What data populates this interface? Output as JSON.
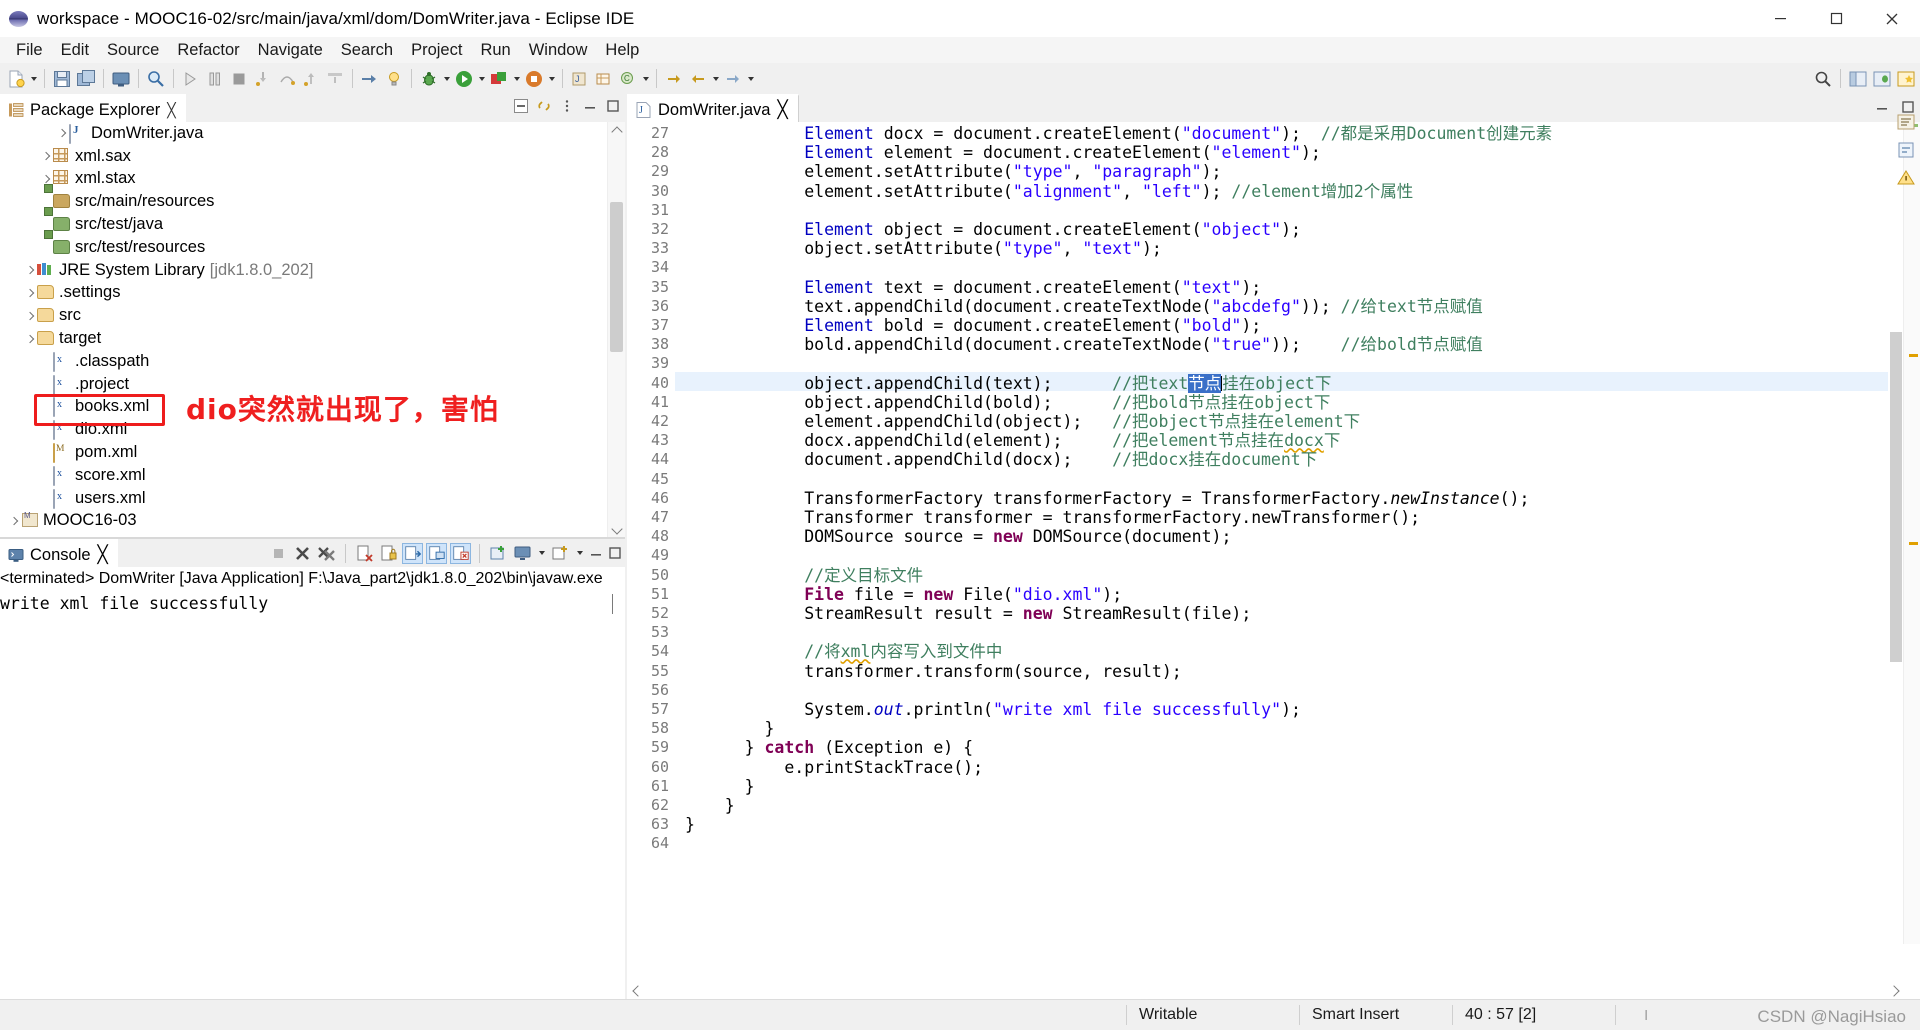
{
  "window": {
    "title": "workspace - MOOC16-02/src/main/java/xml/dom/DomWriter.java - Eclipse IDE",
    "app_icon": "eclipse-sphere-icon",
    "minimize": "minimize-icon",
    "maximize": "maximize-icon",
    "close": "close-icon"
  },
  "menubar": [
    "File",
    "Edit",
    "Source",
    "Refactor",
    "Navigate",
    "Search",
    "Project",
    "Run",
    "Window",
    "Help"
  ],
  "package_explorer": {
    "tab_label": "Package Explorer",
    "close_glyph": "╳",
    "tree": [
      {
        "indent": 3,
        "arrow": true,
        "icon": "java-file-icon",
        "label": "DomWriter.java",
        "sub": ""
      },
      {
        "indent": 2,
        "arrow": true,
        "icon": "package-icon",
        "label": "xml.sax",
        "sub": ""
      },
      {
        "indent": 2,
        "arrow": true,
        "icon": "package-icon",
        "label": "xml.stax",
        "sub": ""
      },
      {
        "indent": 2,
        "arrow": false,
        "icon": "source-folder-icon",
        "label": "src/main/resources",
        "sub": ""
      },
      {
        "indent": 2,
        "arrow": false,
        "icon": "source-folder-green-icon",
        "label": "src/test/java",
        "sub": ""
      },
      {
        "indent": 2,
        "arrow": false,
        "icon": "source-folder-green-icon",
        "label": "src/test/resources",
        "sub": ""
      },
      {
        "indent": 1,
        "arrow": true,
        "icon": "jre-library-icon",
        "label": "JRE System Library",
        "sub": "[jdk1.8.0_202]"
      },
      {
        "indent": 1,
        "arrow": true,
        "icon": "folder-icon",
        "label": ".settings",
        "sub": ""
      },
      {
        "indent": 1,
        "arrow": true,
        "icon": "folder-icon",
        "label": "src",
        "sub": ""
      },
      {
        "indent": 1,
        "arrow": true,
        "icon": "folder-icon",
        "label": "target",
        "sub": ""
      },
      {
        "indent": 2,
        "arrow": false,
        "icon": "xml-file-icon",
        "label": ".classpath",
        "sub": ""
      },
      {
        "indent": 2,
        "arrow": false,
        "icon": "xml-file-icon",
        "label": ".project",
        "sub": ""
      },
      {
        "indent": 2,
        "arrow": false,
        "icon": "xml-file-icon",
        "label": "books.xml",
        "sub": ""
      },
      {
        "indent": 2,
        "arrow": false,
        "icon": "xml-file-icon",
        "label": "dio.xml",
        "sub": ""
      },
      {
        "indent": 2,
        "arrow": false,
        "icon": "maven-pom-icon",
        "label": "pom.xml",
        "sub": ""
      },
      {
        "indent": 2,
        "arrow": false,
        "icon": "xml-file-icon",
        "label": "score.xml",
        "sub": ""
      },
      {
        "indent": 2,
        "arrow": false,
        "icon": "xml-file-icon",
        "label": "users.xml",
        "sub": ""
      },
      {
        "indent": 0,
        "arrow": true,
        "icon": "maven-project-icon",
        "label": "MOOC16-03",
        "sub": ""
      }
    ]
  },
  "annotation": {
    "text": "dio突然就出现了，害怕",
    "color": "#ef1f1f",
    "highlight_target": "dio.xml"
  },
  "console": {
    "tab_label": "Console",
    "close_glyph": "╳",
    "header": "<terminated> DomWriter [Java Application] F:\\Java_part2\\jdk1.8.0_202\\bin\\javaw.exe",
    "output": "write xml file successfully"
  },
  "editor": {
    "tab_label": "DomWriter.java",
    "close_glyph": "╳",
    "first_line_number": 27,
    "last_line_number": 64,
    "highlighted_line": 40,
    "lines": [
      {
        "n": 27,
        "html": "            <span class='fld'>Element</span> docx = document.createElement(<span class='str'>\"document\"</span>);  <span class='cm'>//都是采用Document创建元素</span>"
      },
      {
        "n": 28,
        "html": "            <span class='fld'>Element</span> element = document.createElement(<span class='str'>\"element\"</span>);"
      },
      {
        "n": 29,
        "html": "            element.setAttribute(<span class='str'>\"type\"</span>, <span class='str'>\"paragraph\"</span>);"
      },
      {
        "n": 30,
        "html": "            element.setAttribute(<span class='str'>\"alignment\"</span>, <span class='str'>\"left\"</span>); <span class='cm'>//element增加2个属性</span>"
      },
      {
        "n": 31,
        "html": ""
      },
      {
        "n": 32,
        "html": "            <span class='fld'>Element</span> object = document.createElement(<span class='str'>\"object\"</span>);"
      },
      {
        "n": 33,
        "html": "            object.setAttribute(<span class='str'>\"type\"</span>, <span class='str'>\"text\"</span>);"
      },
      {
        "n": 34,
        "html": ""
      },
      {
        "n": 35,
        "html": "            <span class='fld'>Element</span> text = document.createElement(<span class='str'>\"text\"</span>);"
      },
      {
        "n": 36,
        "html": "            text.appendChild(document.createTextNode(<span class='str'>\"abcdefg\"</span>)); <span class='cm'>//给text节点赋值</span>"
      },
      {
        "n": 37,
        "html": "            <span class='fld'>Element</span> bold = document.createElement(<span class='str'>\"bold\"</span>);"
      },
      {
        "n": 38,
        "html": "            bold.appendChild(document.createTextNode(<span class='str'>\"true\"</span>));    <span class='cm'>//给bold节点赋值</span>"
      },
      {
        "n": 39,
        "html": ""
      },
      {
        "n": 40,
        "html": "            object.appendChild(text);      <span class='cm'>//把text<span class='sel'>节点</span><span class='caret'></span>挂在object下</span>"
      },
      {
        "n": 41,
        "html": "            object.appendChild(bold);      <span class='cm'>//把bold节点挂在object下</span>"
      },
      {
        "n": 42,
        "html": "            element.appendChild(object);   <span class='cm'>//把object节点挂在element下</span>"
      },
      {
        "n": 43,
        "html": "            docx.appendChild(element);     <span class='cm'>//把element节点挂在<span class='sq'>docx</span>下</span>"
      },
      {
        "n": 44,
        "html": "            document.appendChild(docx);    <span class='cm'>//把docx挂在document下</span>"
      },
      {
        "n": 45,
        "html": ""
      },
      {
        "n": 46,
        "html": "            TransformerFactory transformerFactory = TransformerFactory.<span class='stm'>newInstance</span>();"
      },
      {
        "n": 47,
        "html": "            Transformer transformer = transformerFactory.newTransformer();"
      },
      {
        "n": 48,
        "html": "            DOMSource source = <span class='kw'>new</span> DOMSource(document);"
      },
      {
        "n": 49,
        "html": ""
      },
      {
        "n": 50,
        "html": "            <span class='cm'>//定义目标文件</span>"
      },
      {
        "n": 51,
        "html": "            <span class='kw'>File</span> file = <span class='kw'>new</span> File(<span class='str'>\"dio.xml\"</span>);"
      },
      {
        "n": 52,
        "html": "            StreamResult result = <span class='kw'>new</span> StreamResult(file);"
      },
      {
        "n": 53,
        "html": ""
      },
      {
        "n": 54,
        "html": "            <span class='cm'>//将<span class='sq'>xml</span>内容写入到文件中</span>"
      },
      {
        "n": 55,
        "html": "            transformer.transform(source, result);"
      },
      {
        "n": 56,
        "html": ""
      },
      {
        "n": 57,
        "html": "            System.<span class='sfld'>out</span>.println(<span class='str'>\"write xml file successfully\"</span>);"
      },
      {
        "n": 58,
        "html": "        }"
      },
      {
        "n": 59,
        "html": "      } <span class='kw'>catch</span> (Exception e) {"
      },
      {
        "n": 60,
        "html": "          e.printStackTrace();"
      },
      {
        "n": 61,
        "html": "      }"
      },
      {
        "n": 62,
        "html": "    }"
      },
      {
        "n": 63,
        "html": "}"
      },
      {
        "n": 64,
        "html": ""
      }
    ]
  },
  "statusbar": {
    "writable": "Writable",
    "insert_mode": "Smart Insert",
    "position": "40 : 57 [2]"
  },
  "watermark": "CSDN @NagiHsiao",
  "colors": {
    "accent_selection": "#3a70c8",
    "line_highlight": "#e8f2fd",
    "annotation_red": "#ef1f1f",
    "string_blue": "#2a00ff",
    "comment_green": "#3f7f5f",
    "keyword_purple": "#7f0055"
  }
}
